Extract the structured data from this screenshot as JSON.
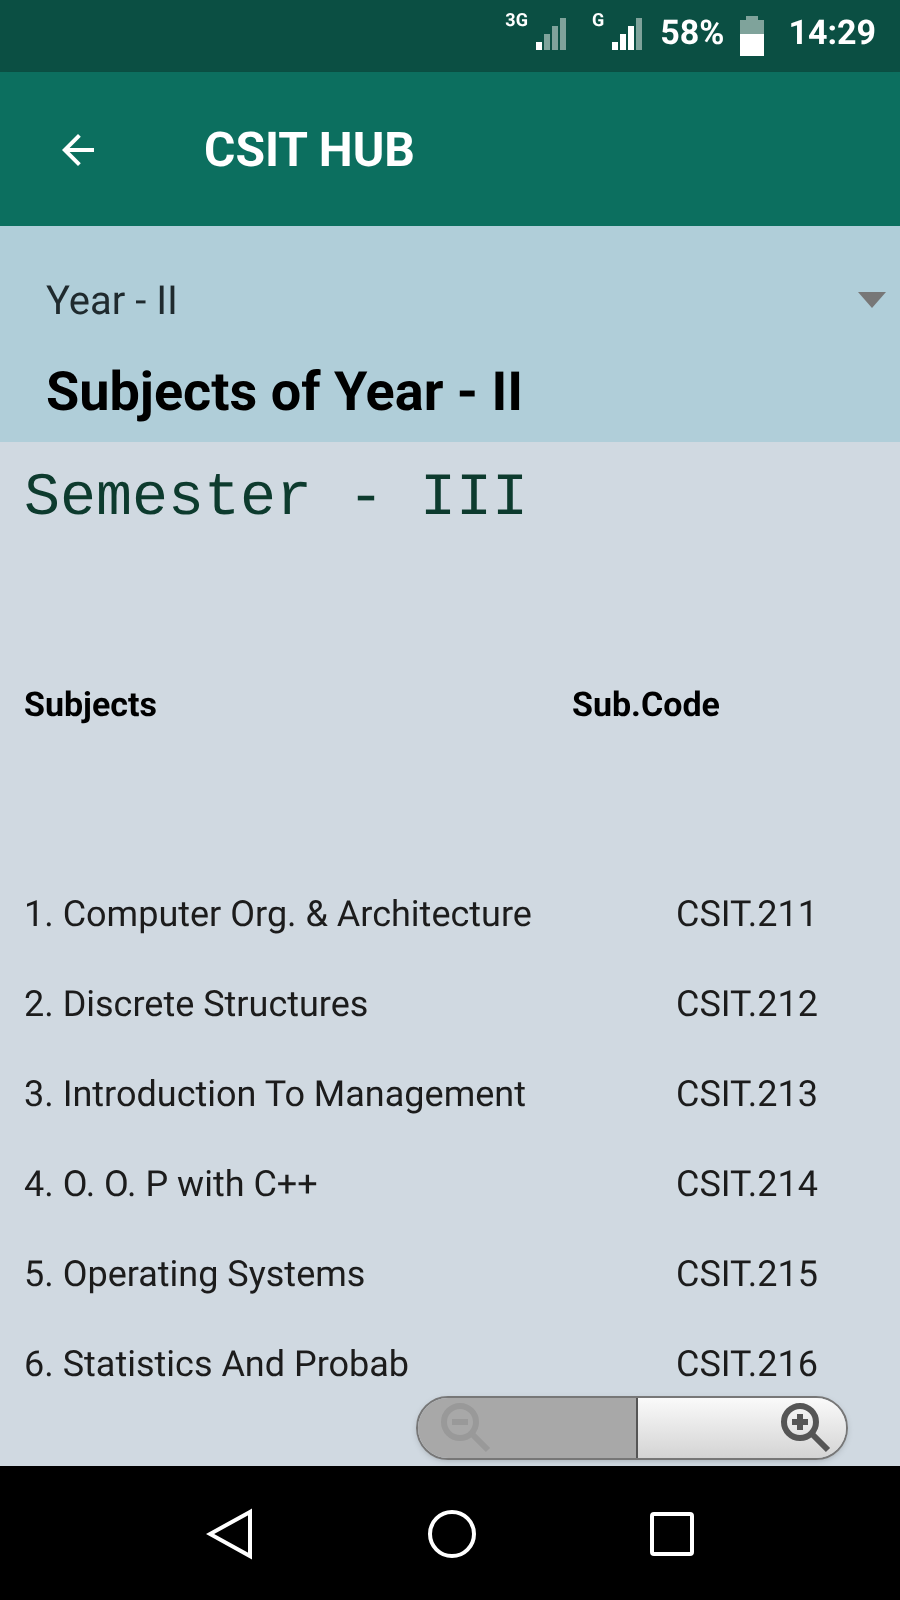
{
  "status_bar": {
    "network_1": "3G",
    "network_2": "G",
    "battery": "58%",
    "time": "14:29"
  },
  "toolbar": {
    "title": "CSIT HUB"
  },
  "year_select": {
    "value": "Year - II"
  },
  "heading": "Subjects of Year - II",
  "semester": "Semester - III",
  "table": {
    "columns": [
      "Subjects",
      "Sub.Code"
    ],
    "rows": [
      {
        "subject": "1. Computer Org. & Architecture",
        "code": "CSIT.211"
      },
      {
        "subject": "2. Discrete Structures",
        "code": "CSIT.212"
      },
      {
        "subject": "3. Introduction To Management",
        "code": "CSIT.213"
      },
      {
        "subject": "4. O. O. P with C++",
        "code": "CSIT.214"
      },
      {
        "subject": "5. Operating Systems",
        "code": "CSIT.215"
      },
      {
        "subject": "6. Statistics And Probab",
        "code": "CSIT.216"
      }
    ]
  },
  "zoom_controls": {
    "zoom_out_disabled": true
  }
}
